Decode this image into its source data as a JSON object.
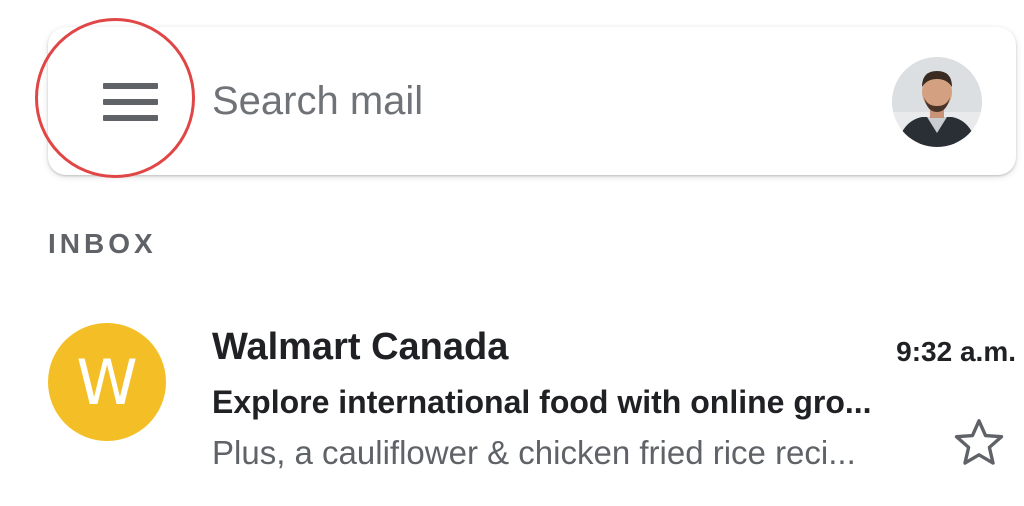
{
  "search": {
    "placeholder": "Search mail"
  },
  "inbox": {
    "label": "INBOX"
  },
  "emails": [
    {
      "avatar_letter": "W",
      "avatar_color": "#f4bf26",
      "sender": "Walmart Canada",
      "time": "9:32 a.m.",
      "subject": "Explore international food with online gro...",
      "snippet": "Plus, a cauliflower & chicken fried rice reci...",
      "starred": false
    }
  ],
  "colors": {
    "highlight": "#e14646",
    "menu_icon": "#5f6368"
  },
  "icons": {
    "menu": "hamburger-menu-icon",
    "star": "star-outline-icon",
    "account": "account-avatar"
  }
}
